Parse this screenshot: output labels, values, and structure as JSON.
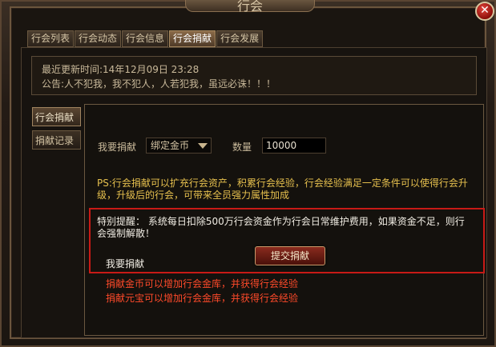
{
  "window": {
    "title": "行会"
  },
  "tabs": [
    "行会列表",
    "行会动态",
    "行会信息",
    "行会捐献",
    "行会发展"
  ],
  "notice": {
    "updated": "最近更新时间:14年12月09日 23:28",
    "announcement": "公告:人不犯我，我不犯人，人若犯我，虽远必诛！！！"
  },
  "side_tabs": [
    "行会捐献",
    "捐献记录"
  ],
  "form": {
    "donate_label": "我要捐献",
    "currency_value": "绑定金币",
    "qty_label": "数量",
    "qty_value": "10000"
  },
  "ps_text": "PS:行会捐献可以扩充行会资产，积累行会经验，行会经验满足一定条件可以使得行会升级，升级后的行会，可带来全员强力属性加成",
  "warning": {
    "text": "特别提醒：  系统每日扣除500万行会资金作为行会日常维护费用，如果资金不足，则行会强制解散！",
    "donate_label": "我要捐献",
    "submit_label": "提交捐献"
  },
  "hints": [
    "捐献金币可以增加行会金库，并获得行会经验",
    "捐献元宝可以增加行会金库，并获得行会经验"
  ],
  "colors": {
    "ps": "#e6c04e",
    "hint": "#ff4a2a",
    "warn_border": "#c81a16"
  }
}
